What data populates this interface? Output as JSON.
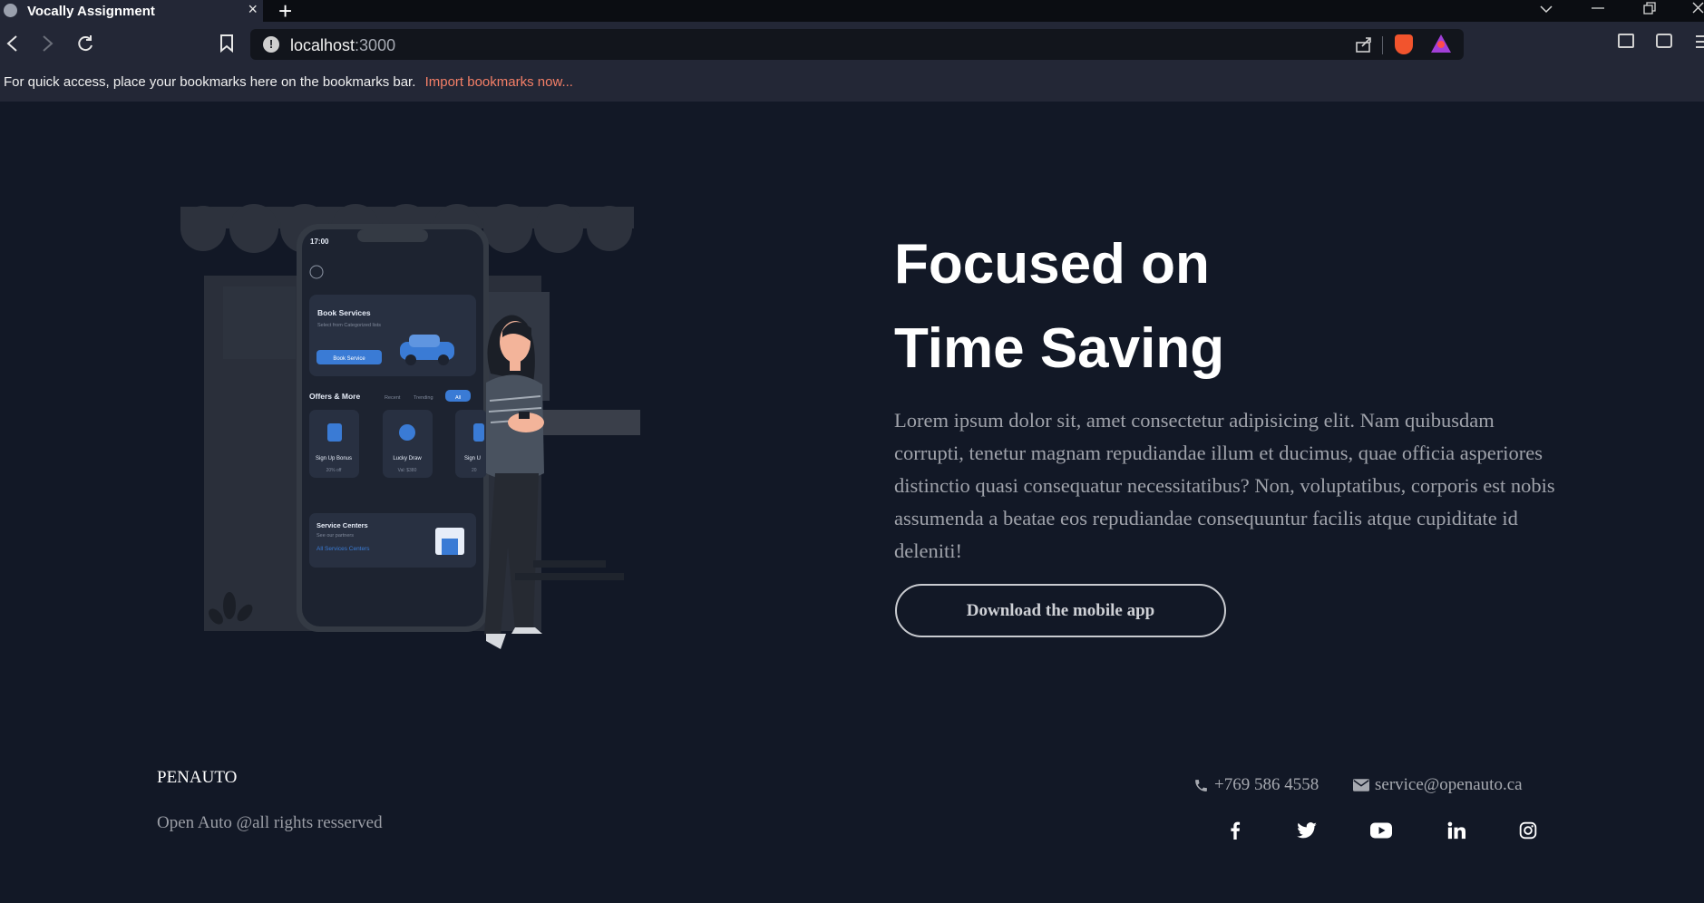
{
  "browser": {
    "tab_title": "Vocally Assignment",
    "tab_close": "×",
    "new_tab": "+",
    "url_host": "localhost",
    "url_port": ":3000",
    "bookmarks_message": "For quick access, place your bookmarks here on the bookmarks bar.",
    "bookmarks_link": "Import bookmarks now..."
  },
  "hero": {
    "title_line1": "Focused on",
    "title_line2": "Time Saving",
    "body": "Lorem ipsum dolor sit, amet consectetur adipisicing elit. Nam quibusdam corrupti, tenetur magnam repudiandae illum et ducimus, quae officia asperiores distinctio quasi consequatur necessitatibus? Non, voluptatibus, corporis est nobis assumenda a beatae eos repudiandae consequuntur facilis atque cupiditate id deleniti!",
    "cta": "Download the mobile app"
  },
  "phone": {
    "time": "17:00",
    "book_title": "Book Services",
    "book_sub": "Select from Categorized lists",
    "book_btn": "Book Service",
    "offers_title": "Offers & More",
    "filter_recent": "Recent",
    "filter_trending": "Trending",
    "filter_all": "All",
    "card1_title": "Sign Up Bonus",
    "card1_sub": "20% off",
    "card2_title": "Lucky Draw",
    "card2_sub": "Val: $380",
    "card3_title": "Sign U",
    "card3_sub": "20",
    "service_title": "Service Centers",
    "service_sub": "See our partners",
    "service_link": "All Services Centers"
  },
  "footer": {
    "brand": "PENAUTO",
    "copyright": "Open Auto @all rights resserved",
    "phone": "+769 586 4558",
    "email": "service@openauto.ca",
    "social": [
      "facebook-icon",
      "twitter-icon",
      "youtube-icon",
      "linkedin-icon",
      "instagram-icon"
    ]
  },
  "colors": {
    "background": "#121826",
    "chrome": "#232736",
    "accent_blue": "#3a7bd5",
    "link_orange": "#f47f67"
  }
}
